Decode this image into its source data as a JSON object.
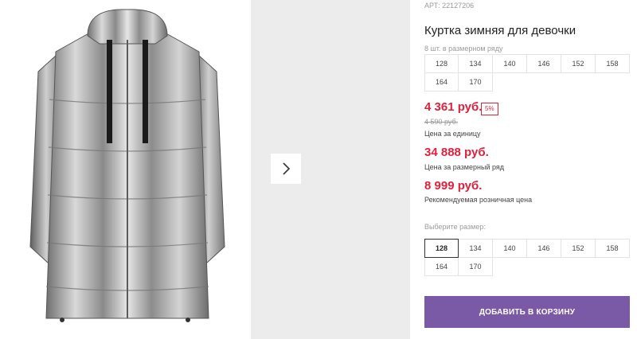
{
  "product": {
    "article": "АРТ: 22127206",
    "title": "Куртка зимняя для девочки"
  },
  "pack": {
    "label": "8 шт. в размерном ряду",
    "sizes": [
      "128",
      "134",
      "140",
      "146",
      "152",
      "158",
      "164",
      "170"
    ]
  },
  "prices": {
    "current": "4 361 руб.",
    "discount": "5%",
    "old": "4 590 руб.",
    "unit_label": "Цена за единицу",
    "pack_price": "34 888 руб.",
    "pack_label": "Цена за размерный ряд",
    "retail_price": "8 999 руб.",
    "retail_label": "Рекомендуемая розничная цена"
  },
  "size_select": {
    "label": "Выберите размер:",
    "sizes": [
      "128",
      "134",
      "140",
      "146",
      "152",
      "158",
      "164",
      "170"
    ],
    "selected": "128"
  },
  "actions": {
    "add_to_cart": "ДОБАВИТЬ В КОРЗИНУ"
  },
  "gallery": {
    "next_icon": "chevron-right-icon"
  },
  "colors": {
    "accent": "#7a5aa6",
    "price": "#e1203c",
    "gallery_bg": "#ececec"
  }
}
